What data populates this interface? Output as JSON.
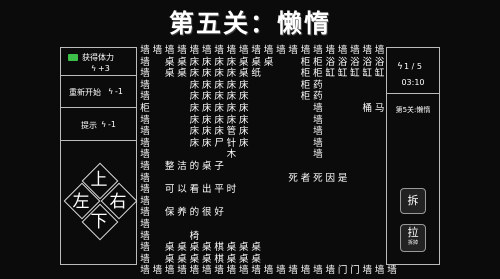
{
  "title": "第五关：懒惰",
  "left_panel": {
    "get_stamina": "获得体力",
    "stamina_bonus": "+3",
    "restart": "重新开始",
    "restart_cost": "-1",
    "hint": "提示",
    "hint_cost": "-1"
  },
  "dpad": {
    "up": "上",
    "left": "左",
    "right": "右",
    "down": "下"
  },
  "right_panel": {
    "stamina": "1 / 5",
    "timer": "03:10",
    "level_name": "第5关:懒惰",
    "action1": "拆",
    "action2": "拉",
    "action2_sub": "拆掉"
  },
  "board_rows": [
    "墙墙墙墙墙墙墙墙墙墙墙墙墙墙墙墙墙墙墙墙",
    "墙　桌桌床床床床桌桌桌　　柜柜浴浴浴浴浴墙",
    "墙　桌桌床床床床桌纸　　　柜柜缸缸缸缸缸墙",
    "墙　　　床床床床床　　　　柜药　　　　　墙",
    "墙　　　床床床床床　　　　柜药　　　　　墙",
    "柜　　　床床床床床　　　　　墙　　　桶马墙",
    "墙　　　床床床床床　　　　　墙　　　　　墙",
    "墙　　　床床床管床　　　　　墙　　　　　墙",
    "墙　　　床床尸针床　　　　　墙　　　　　墙",
    "墙　　　　　　木　　　　　　墙　　　　　墙",
    "墙　整洁的桌子　　　　　　　　　　　　　墙",
    "墙　　　　　　　　　　　死者死因是　　　墙",
    "墙　可以看出平时　　　　　　　　　　　　墙",
    "墙　　　　　　　　　　　　　　　　　　　墙",
    "墙　保养的很好　　　　　　　　　　　　　墙",
    "墙　　　　　　　　　　　　　　　　　　　墙",
    "墙　　　椅　　　　　　　　　　　　　　　墙",
    "墙　桌桌桌桌棋桌桌桌　　　　　　　　　　墙",
    "墙　桌桌桌桌棋桌桌桌　　　　　　　　　　墙",
    "墙墙墙墙墙墙墙墙墙墙墙墙墙墙墙墙门门墙墙墙"
  ]
}
